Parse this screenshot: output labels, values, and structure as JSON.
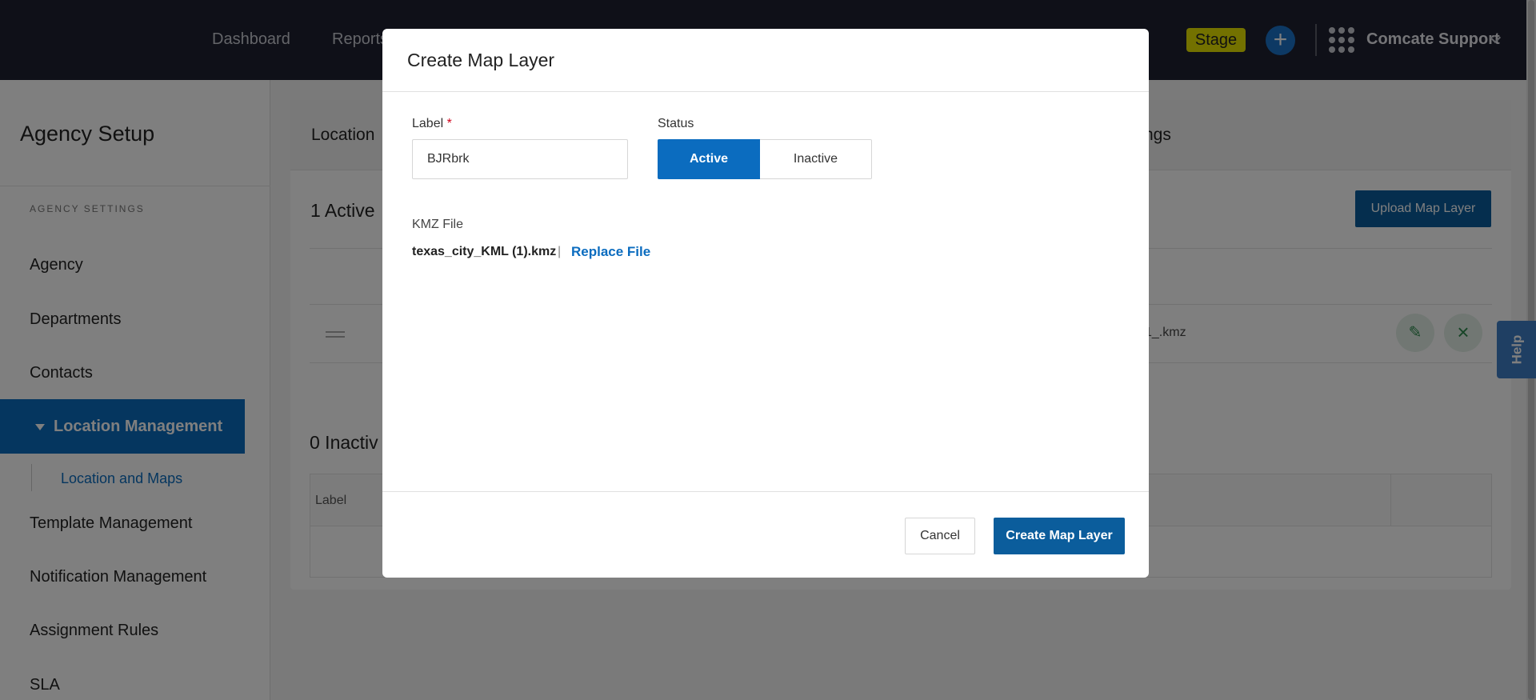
{
  "topbar": {
    "nav": [
      "Dashboard",
      "Reports"
    ],
    "stage_badge": "Stage",
    "plus_icon": "+",
    "user_name": "Comcate Support"
  },
  "sidebar": {
    "title": "Agency Setup",
    "section": "AGENCY SETTINGS",
    "items": [
      "Agency",
      "Departments",
      "Contacts",
      "Location Management",
      "Location and Maps",
      "Template Management",
      "Notification Management",
      "Assignment Rules",
      "SLA"
    ]
  },
  "content": {
    "header_left": "Location",
    "header_right": "ngs",
    "active_count": "1 Active",
    "upload_button": "Upload Map Layer",
    "row_file": "1_.kmz",
    "inactive_count": "0 Inactiv",
    "inactive_col_label": "Label",
    "help": "Help"
  },
  "modal": {
    "title": "Create Map Layer",
    "label_field": {
      "label": "Label",
      "required": "*",
      "value": "BJRbrk"
    },
    "status": {
      "label": "Status",
      "active": "Active",
      "inactive": "Inactive"
    },
    "kmz": {
      "label": "KMZ File",
      "file": "texas_city_KML (1).kmz",
      "sep": "|",
      "replace": "Replace File"
    },
    "cancel": "Cancel",
    "create": "Create Map Layer"
  },
  "colors": {
    "primary": "#0b6cbf",
    "nav_bg": "#1f2130",
    "badge": "#e6e300"
  }
}
